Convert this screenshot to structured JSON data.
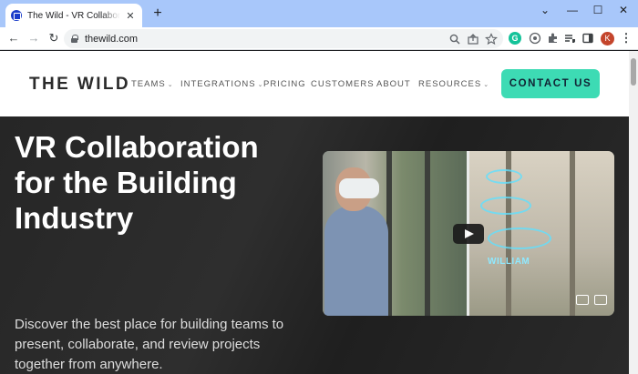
{
  "browser": {
    "tab": {
      "title": "The Wild - VR Collaboration for Architecture",
      "close": "✕",
      "favicon": "the-wild-favicon"
    },
    "new_tab": "+",
    "window_controls": {
      "minimize": "—",
      "maximize": "☐",
      "close": "✕",
      "tab_search": "⌄"
    },
    "nav": {
      "back": "←",
      "forward": "→",
      "reload": "↻"
    },
    "address": {
      "url": "thewild.com"
    },
    "toolbar_icons": [
      "zoom-icon",
      "share-icon",
      "bookmark-star-icon"
    ],
    "extensions": [
      "grammarly-icon",
      "extension-icon",
      "puzzle-icon",
      "reading-list-icon",
      "side-panel-icon"
    ],
    "profile_initial": "K",
    "menu": "⋮"
  },
  "site": {
    "logo": "THE WILD",
    "nav": [
      {
        "label": "TEAMS",
        "dropdown": true
      },
      {
        "label": "INTEGRATIONS",
        "dropdown": true
      },
      {
        "label": "PRICING",
        "dropdown": false
      },
      {
        "label": "CUSTOMERS",
        "dropdown": false
      },
      {
        "label": "ABOUT",
        "dropdown": false
      },
      {
        "label": "RESOURCES",
        "dropdown": true
      }
    ],
    "cta": "CONTACT US",
    "hero": {
      "title": "VR Collaboration for the Building Industry",
      "subtitle": "Discover the best place for building teams to present, collaborate, and review projects together from anywhere."
    },
    "video": {
      "scene_label": "WILLIAM"
    }
  },
  "colors": {
    "accent": "#3ddbb4",
    "hero_bg": "#262626",
    "tab_strip": "#a8c7fa"
  }
}
